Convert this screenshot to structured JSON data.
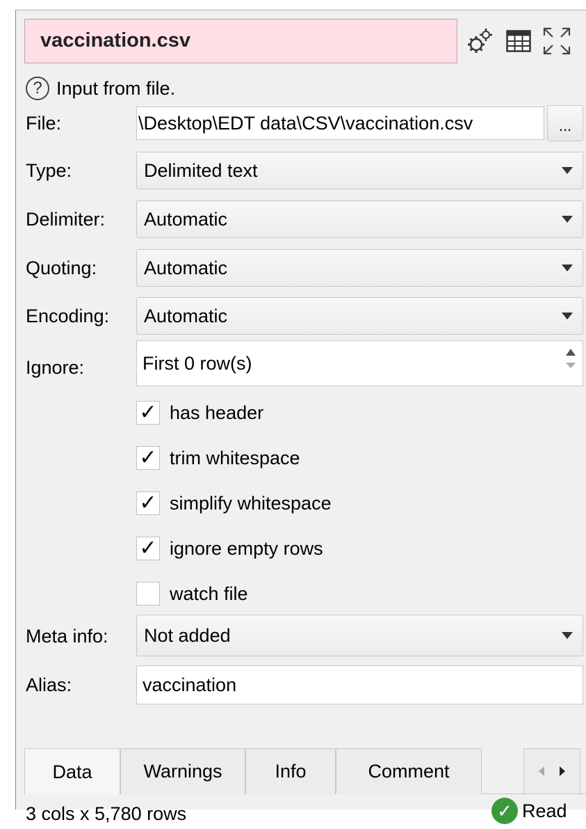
{
  "header": {
    "title": "vaccination.csv",
    "icons": [
      "settings-gears-icon",
      "table-view-icon",
      "maximize-icon"
    ]
  },
  "help": {
    "text": "Input from file.",
    "icon": "help-question-icon"
  },
  "form": {
    "file": {
      "label": "File:",
      "value": "\\Desktop\\EDT data\\CSV\\vaccination.csv",
      "browse_label": "..."
    },
    "type": {
      "label": "Type:",
      "value": "Delimited text"
    },
    "delimiter": {
      "label": "Delimiter:",
      "value": "Automatic"
    },
    "quoting": {
      "label": "Quoting:",
      "value": "Automatic"
    },
    "encoding": {
      "label": "Encoding:",
      "value": "Automatic"
    },
    "ignore": {
      "label": "Ignore:",
      "value": "First 0 row(s)"
    },
    "checkboxes": [
      {
        "label": "has header",
        "checked": true
      },
      {
        "label": "trim whitespace",
        "checked": true
      },
      {
        "label": "simplify whitespace",
        "checked": true
      },
      {
        "label": "ignore empty rows",
        "checked": true
      },
      {
        "label": "watch file",
        "checked": false
      }
    ],
    "meta_info": {
      "label": "Meta info:",
      "value": "Not added"
    },
    "alias": {
      "label": "Alias:",
      "value": "vaccination"
    }
  },
  "tabs": [
    {
      "label": "Data",
      "active": true
    },
    {
      "label": "Warnings",
      "active": false
    },
    {
      "label": "Info",
      "active": false
    },
    {
      "label": "Comment",
      "active": false
    }
  ],
  "status": {
    "summary": "3 cols x 5,780 rows",
    "state": "Read",
    "state_icon": "check-ok-icon"
  },
  "colors": {
    "title_bg": "#ffdfe6",
    "panel_bg": "#f0f0f0",
    "ok_green": "#3a9a3a"
  }
}
